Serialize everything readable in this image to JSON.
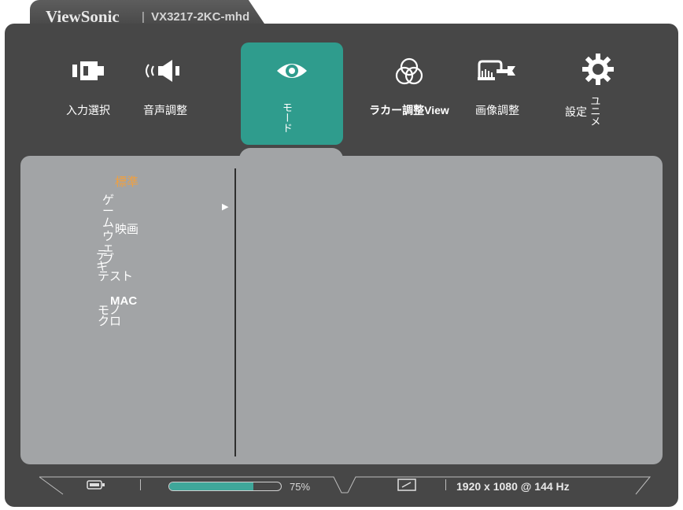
{
  "header": {
    "brand": "ViewSonic",
    "separator": "|",
    "model": "VX3217-2KC-mhd"
  },
  "menu": {
    "items": [
      {
        "id": "input",
        "label": "入力選択",
        "icon": "input-source-icon"
      },
      {
        "id": "audio",
        "label": "音声調整",
        "icon": "speaker-icon"
      },
      {
        "id": "mode",
        "label": "モード",
        "icon": "eye-icon",
        "active": true
      },
      {
        "id": "color",
        "label": "ラカー調整View",
        "icon": "color-circles-icon"
      },
      {
        "id": "picture",
        "label": "画像調整",
        "icon": "monitor-wrench-icon"
      },
      {
        "id": "setup",
        "label": "設定",
        "label_suffix": "ユニメ",
        "icon": "gear-icon"
      }
    ]
  },
  "submenu": {
    "selected": "標準",
    "items": [
      "ゲーム",
      "映画",
      "ウェブ",
      "テキ",
      "テスト",
      "MAC",
      "モノクロ"
    ]
  },
  "status": {
    "progress_label": "75%",
    "progress_value": 0.75,
    "resolution": "1920 x 1080 @ 144 Hz"
  },
  "colors": {
    "accent": "#2f9c8d",
    "frame": "#474747",
    "panel": "#a2a4a6",
    "selected_text": "#f0a040"
  }
}
